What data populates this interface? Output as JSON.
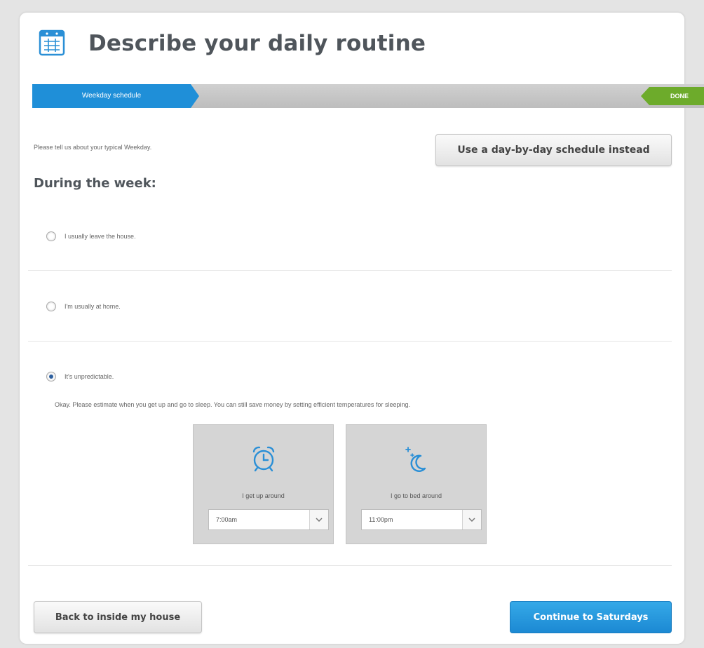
{
  "header": {
    "title": "Describe your daily routine",
    "icon": "calendar-icon"
  },
  "progress": {
    "active_step": "Weekday schedule",
    "done_label": "DONE",
    "active_color": "#1f8fd8",
    "done_color": "#6dab2b"
  },
  "intro_text": "Please tell us about your typical Weekday.",
  "alt_schedule_button": "Use a day-by-day schedule instead",
  "section_heading": "During the week:",
  "options": [
    {
      "label": "I usually leave the house.",
      "checked": false
    },
    {
      "label": "I'm usually at home.",
      "checked": false
    },
    {
      "label": "It's unpredictable.",
      "checked": true
    }
  ],
  "estimate_text": "Okay. Please estimate when you get up and go to sleep. You can still save money by setting efficient temperatures for sleeping.",
  "wake": {
    "label": "I get up around",
    "value": "7:00am",
    "icon": "alarm-clock-icon"
  },
  "sleep": {
    "label": "I go to bed around",
    "value": "11:00pm",
    "icon": "moon-stars-icon"
  },
  "footer": {
    "back_label": "Back to inside my house",
    "continue_label": "Continue to Saturdays",
    "primary_color": "#1c89d3"
  }
}
